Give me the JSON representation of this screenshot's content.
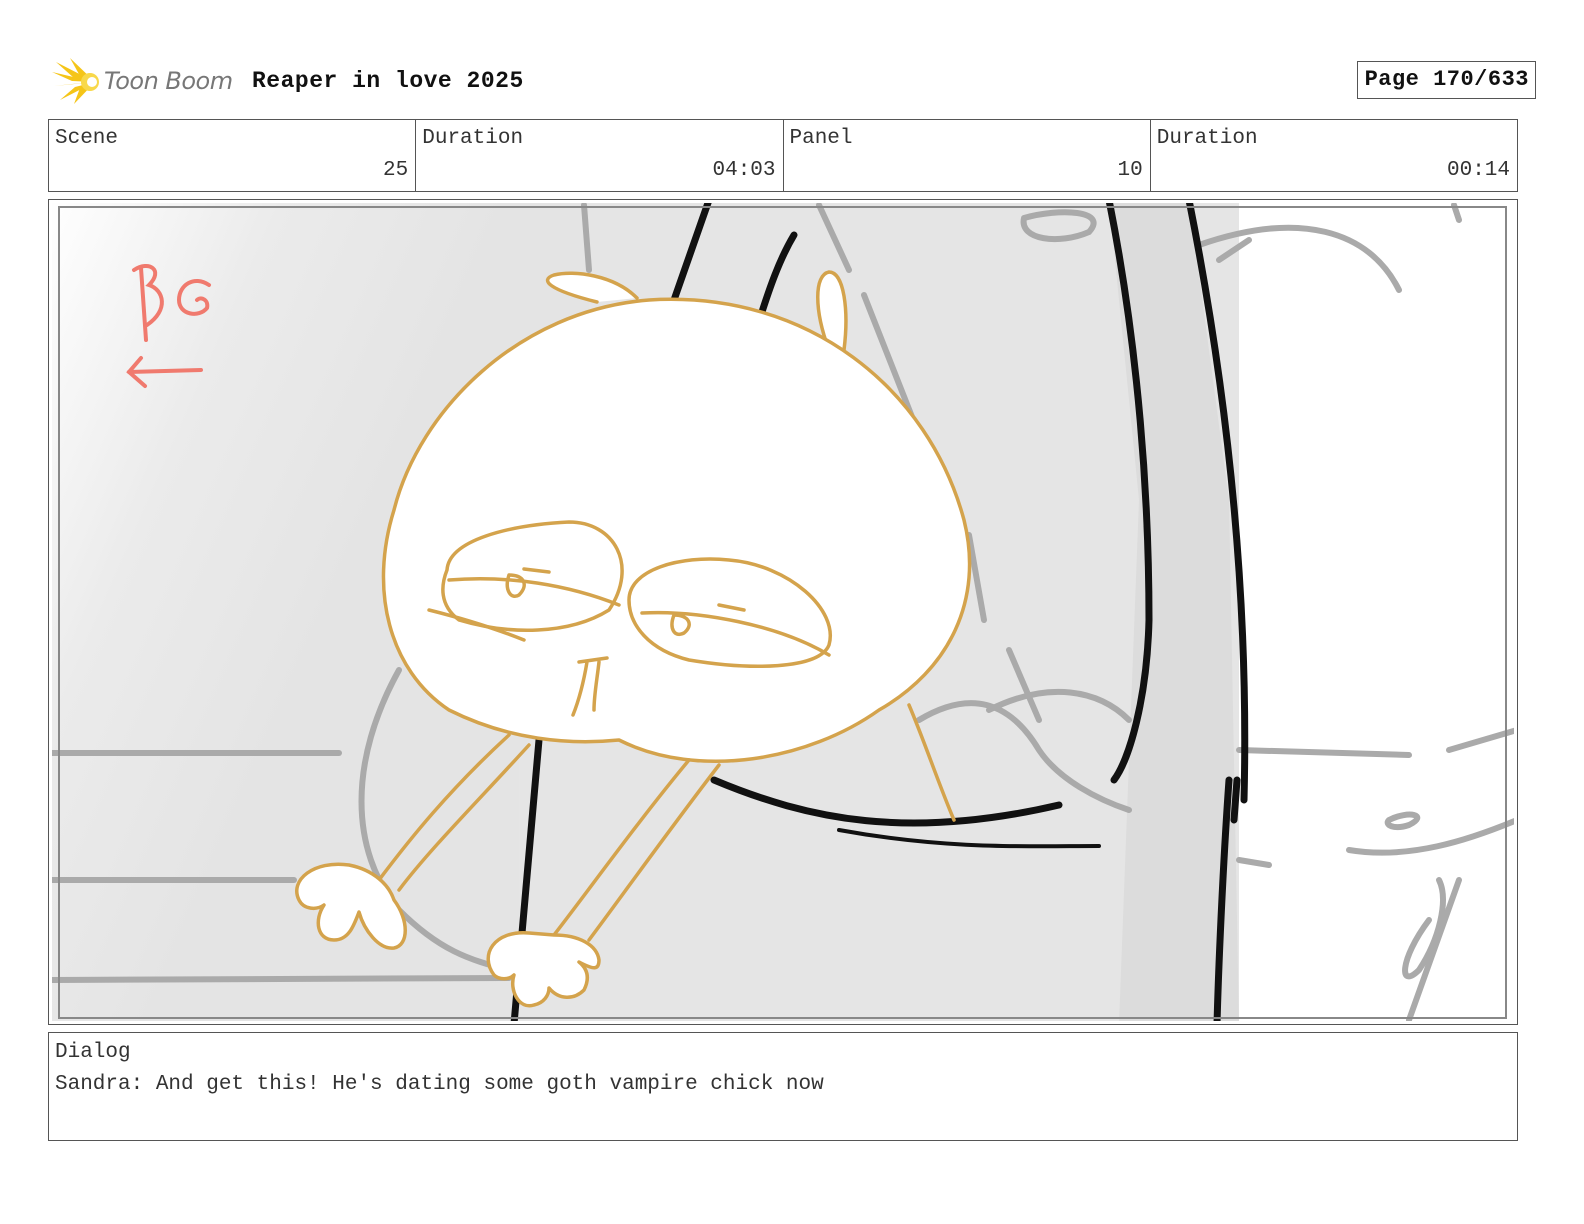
{
  "header": {
    "logo_text": "Toon Boom",
    "title": "Reaper in love 2025",
    "page_label": "Page 170/633"
  },
  "info": {
    "scene_label": "Scene",
    "scene_value": "25",
    "duration1_label": "Duration",
    "duration1_value": "04:03",
    "panel_label": "Panel",
    "panel_value": "10",
    "duration2_label": "Duration",
    "duration2_value": "00:14"
  },
  "panel": {
    "note_text": "BG",
    "colors": {
      "character_line": "#d4a34c",
      "annotation": "#f07a6e",
      "ink": "#111111",
      "background_grey": "#e6e6e6",
      "sketch_grey": "#aaaaaa"
    }
  },
  "dialog": {
    "label": "Dialog",
    "text": "Sandra: And get this! He's dating some goth vampire chick now"
  }
}
